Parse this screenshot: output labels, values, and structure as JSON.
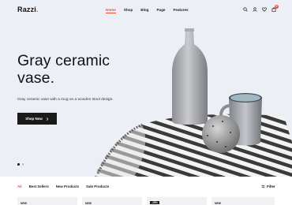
{
  "header": {
    "logo": "Razzi",
    "logo_dot": ".",
    "nav": [
      "Home",
      "Shop",
      "Blog",
      "Page",
      "Features"
    ],
    "active_nav": "Home",
    "cart_count": "0",
    "icons": [
      "search-icon",
      "user-icon",
      "heart-icon",
      "cart-icon"
    ]
  },
  "hero": {
    "title": "Gray ceramic vase.",
    "subtitle": "Gray ceramic vase with a mug on a wooden stool design.",
    "button_label": "Shop Now",
    "slides": 2,
    "active_slide": 1
  },
  "products": {
    "tabs": [
      "All",
      "Best Sellers",
      "New Products",
      "Sale Products"
    ],
    "active_tab": "All",
    "filter_label": "Filter",
    "card_tags": [
      "NEW",
      "NEW",
      "-15%",
      "NEW"
    ]
  },
  "colors": {
    "accent": "#e5533c",
    "hero_bg": "#eceff6",
    "dark": "#1a1a1a"
  }
}
